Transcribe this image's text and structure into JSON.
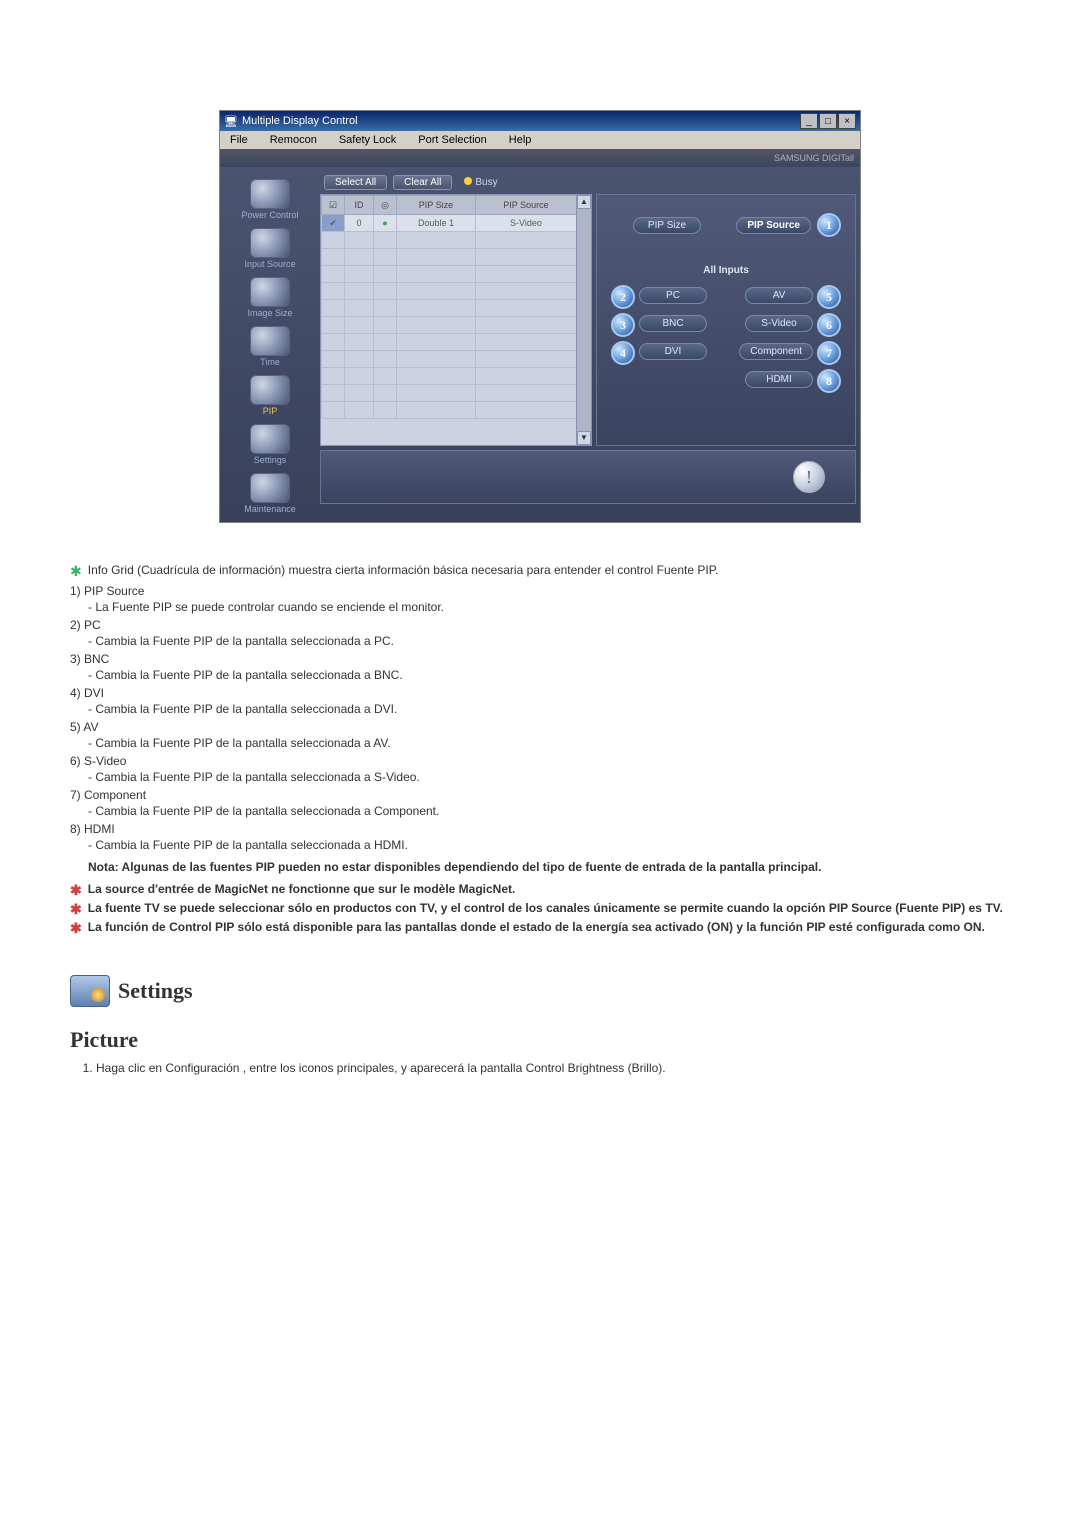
{
  "window": {
    "title": "Multiple Display Control",
    "brand": "SAMSUNG DIGITall"
  },
  "menubar": {
    "file": "File",
    "remocon": "Remocon",
    "safety_lock": "Safety Lock",
    "port_selection": "Port Selection",
    "help": "Help"
  },
  "sidebar": [
    {
      "label": "Power Control"
    },
    {
      "label": "Input Source"
    },
    {
      "label": "Image Size"
    },
    {
      "label": "Time"
    },
    {
      "label": "PIP"
    },
    {
      "label": "Settings"
    },
    {
      "label": "Maintenance"
    }
  ],
  "toprow": {
    "select_all": "Select All",
    "clear_all": "Clear All",
    "busy": "Busy"
  },
  "grid": {
    "headers": [
      "",
      "ID",
      "",
      "PIP Size",
      "PIP Source"
    ],
    "row0": {
      "id": "0",
      "pip_size": "Double 1",
      "pip_source": "S-Video"
    }
  },
  "controls": {
    "pip_size": "PIP Size",
    "pip_source": "PIP Source",
    "all_inputs": "All Inputs",
    "inputs": {
      "pc": "PC",
      "bnc": "BNC",
      "dvi": "DVI",
      "av": "AV",
      "svideo": "S-Video",
      "component": "Component",
      "hdmi": "HDMI"
    }
  },
  "markers": {
    "m1": "1",
    "m2": "2",
    "m3": "3",
    "m4": "4",
    "m5": "5",
    "m6": "6",
    "m7": "7",
    "m8": "8"
  },
  "notes": {
    "info_grid": "Info Grid (Cuadrícula de información) muestra cierta información básica necesaria para entender el control Fuente PIP.",
    "items": [
      {
        "num": "1)",
        "title": "PIP Source",
        "desc": "- La Fuente PIP se puede controlar cuando se enciende el monitor."
      },
      {
        "num": "2)",
        "title": "PC",
        "desc": "- Cambia la Fuente PIP de la pantalla seleccionada a PC."
      },
      {
        "num": "3)",
        "title": "BNC",
        "desc": "- Cambia la Fuente PIP de la pantalla seleccionada a BNC."
      },
      {
        "num": "4)",
        "title": "DVI",
        "desc": "- Cambia la Fuente PIP de la pantalla seleccionada a DVI."
      },
      {
        "num": "5)",
        "title": "AV",
        "desc": "- Cambia la Fuente PIP de la pantalla seleccionada a AV."
      },
      {
        "num": "6)",
        "title": "S-Video",
        "desc": "- Cambia la Fuente PIP de la pantalla seleccionada a S-Video."
      },
      {
        "num": "7)",
        "title": "Component",
        "desc": "- Cambia la Fuente PIP de la pantalla seleccionada a Component."
      },
      {
        "num": "8)",
        "title": "HDMI",
        "desc": "- Cambia la Fuente PIP de la pantalla seleccionada a HDMI."
      }
    ],
    "bold_note": "Nota: Algunas de las fuentes PIP pueden no estar disponibles dependiendo del tipo de fuente de entrada de la pantalla principal.",
    "red1": "La source d'entrée de MagicNet ne fonctionne que sur le modèle MagicNet.",
    "red2": "La fuente TV se puede seleccionar sólo en productos con TV, y el control de los canales únicamente se permite cuando la opción PIP Source (Fuente PIP) es TV.",
    "red3": "La función de Control PIP sólo está disponible para las pantallas donde el estado de la energía sea activado (ON) y la función PIP esté configurada como ON."
  },
  "settings_heading": "Settings",
  "picture_heading": "Picture",
  "picture_step1": "Haga clic en Configuración , entre los iconos principales, y aparecerá la pantalla Control Brightness (Brillo)."
}
